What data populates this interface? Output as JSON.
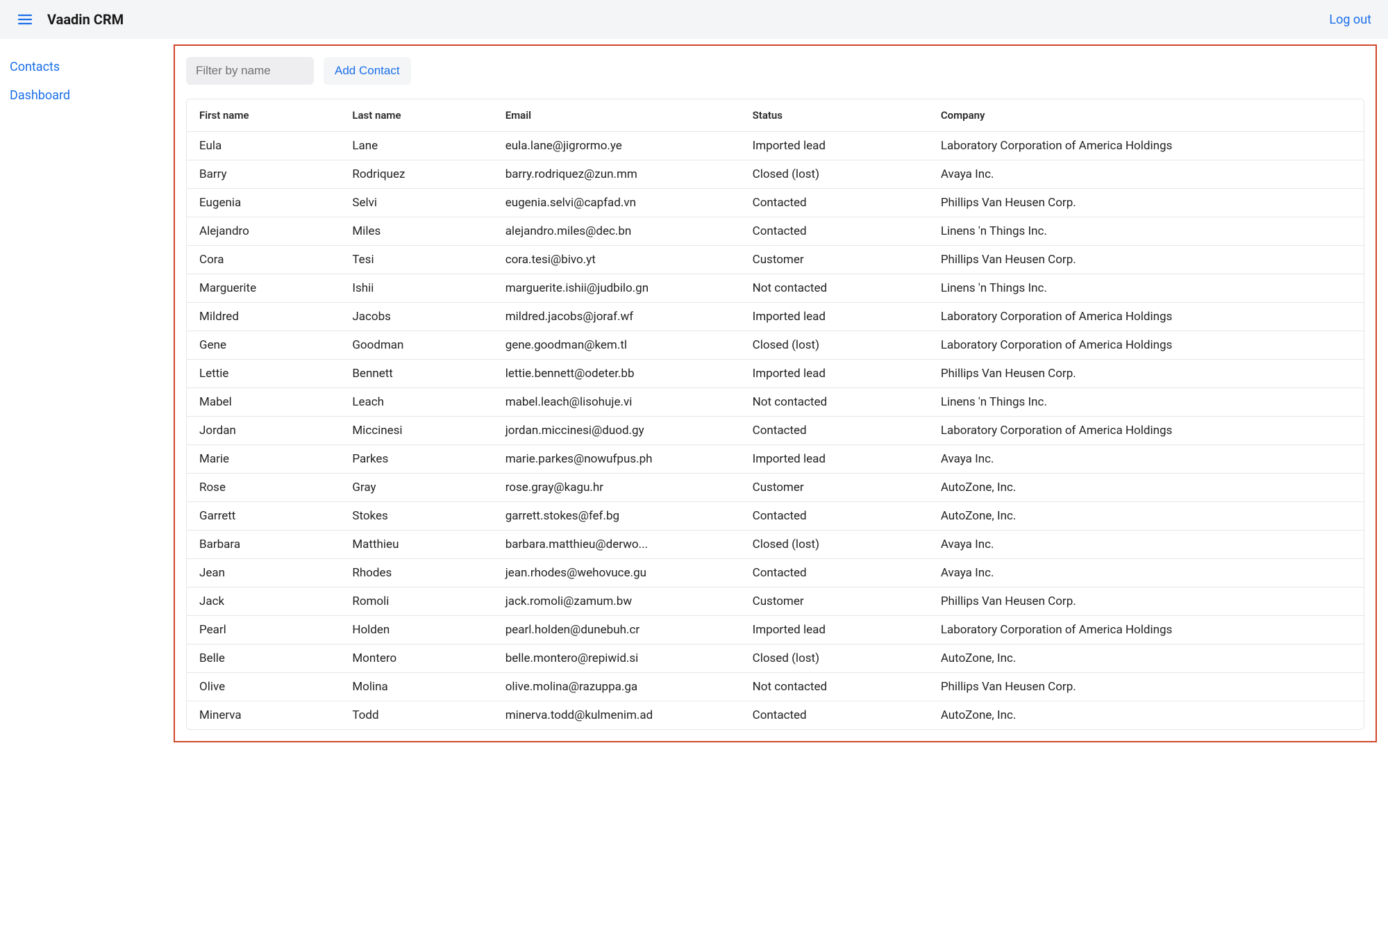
{
  "header": {
    "app_title": "Vaadin CRM",
    "logout_label": "Log out"
  },
  "sidebar": {
    "items": [
      {
        "label": "Contacts"
      },
      {
        "label": "Dashboard"
      }
    ]
  },
  "toolbar": {
    "filter_placeholder": "Filter by name",
    "add_contact_label": "Add Contact"
  },
  "table": {
    "columns": [
      "First name",
      "Last name",
      "Email",
      "Status",
      "Company"
    ],
    "rows": [
      {
        "first": "Eula",
        "last": "Lane",
        "email": "eula.lane@jigrormo.ye",
        "status": "Imported lead",
        "company": "Laboratory Corporation of America Holdings"
      },
      {
        "first": "Barry",
        "last": "Rodriquez",
        "email": "barry.rodriquez@zun.mm",
        "status": "Closed (lost)",
        "company": "Avaya Inc."
      },
      {
        "first": "Eugenia",
        "last": "Selvi",
        "email": "eugenia.selvi@capfad.vn",
        "status": "Contacted",
        "company": "Phillips Van Heusen Corp."
      },
      {
        "first": "Alejandro",
        "last": "Miles",
        "email": "alejandro.miles@dec.bn",
        "status": "Contacted",
        "company": "Linens 'n Things Inc."
      },
      {
        "first": "Cora",
        "last": "Tesi",
        "email": "cora.tesi@bivo.yt",
        "status": "Customer",
        "company": "Phillips Van Heusen Corp."
      },
      {
        "first": "Marguerite",
        "last": "Ishii",
        "email": "marguerite.ishii@judbilo.gn",
        "status": "Not contacted",
        "company": "Linens 'n Things Inc."
      },
      {
        "first": "Mildred",
        "last": "Jacobs",
        "email": "mildred.jacobs@joraf.wf",
        "status": "Imported lead",
        "company": "Laboratory Corporation of America Holdings"
      },
      {
        "first": "Gene",
        "last": "Goodman",
        "email": "gene.goodman@kem.tl",
        "status": "Closed (lost)",
        "company": "Laboratory Corporation of America Holdings"
      },
      {
        "first": "Lettie",
        "last": "Bennett",
        "email": "lettie.bennett@odeter.bb",
        "status": "Imported lead",
        "company": "Phillips Van Heusen Corp."
      },
      {
        "first": "Mabel",
        "last": "Leach",
        "email": "mabel.leach@lisohuje.vi",
        "status": "Not contacted",
        "company": "Linens 'n Things Inc."
      },
      {
        "first": "Jordan",
        "last": "Miccinesi",
        "email": "jordan.miccinesi@duod.gy",
        "status": "Contacted",
        "company": "Laboratory Corporation of America Holdings"
      },
      {
        "first": "Marie",
        "last": "Parkes",
        "email": "marie.parkes@nowufpus.ph",
        "status": "Imported lead",
        "company": "Avaya Inc."
      },
      {
        "first": "Rose",
        "last": "Gray",
        "email": "rose.gray@kagu.hr",
        "status": "Customer",
        "company": "AutoZone, Inc."
      },
      {
        "first": "Garrett",
        "last": "Stokes",
        "email": "garrett.stokes@fef.bg",
        "status": "Contacted",
        "company": "AutoZone, Inc."
      },
      {
        "first": "Barbara",
        "last": "Matthieu",
        "email": "barbara.matthieu@derwo...",
        "status": "Closed (lost)",
        "company": "Avaya Inc."
      },
      {
        "first": "Jean",
        "last": "Rhodes",
        "email": "jean.rhodes@wehovuce.gu",
        "status": "Contacted",
        "company": "Avaya Inc."
      },
      {
        "first": "Jack",
        "last": "Romoli",
        "email": "jack.romoli@zamum.bw",
        "status": "Customer",
        "company": "Phillips Van Heusen Corp."
      },
      {
        "first": "Pearl",
        "last": "Holden",
        "email": "pearl.holden@dunebuh.cr",
        "status": "Imported lead",
        "company": "Laboratory Corporation of America Holdings"
      },
      {
        "first": "Belle",
        "last": "Montero",
        "email": "belle.montero@repiwid.si",
        "status": "Closed (lost)",
        "company": "AutoZone, Inc."
      },
      {
        "first": "Olive",
        "last": "Molina",
        "email": "olive.molina@razuppa.ga",
        "status": "Not contacted",
        "company": "Phillips Van Heusen Corp."
      },
      {
        "first": "Minerva",
        "last": "Todd",
        "email": "minerva.todd@kulmenim.ad",
        "status": "Contacted",
        "company": "AutoZone, Inc."
      }
    ]
  }
}
